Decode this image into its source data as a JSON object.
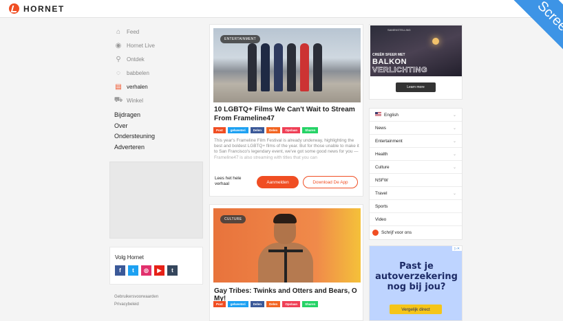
{
  "header": {
    "brand": "HORNET"
  },
  "nav": [
    {
      "label": "Feed",
      "icon": "home-icon",
      "active": false
    },
    {
      "label": "Hornet Live",
      "icon": "broadcast-icon",
      "active": false
    },
    {
      "label": "Ontdek",
      "icon": "search-icon",
      "active": false
    },
    {
      "label": "babbelen",
      "icon": "chat-icon",
      "active": false
    },
    {
      "label": "verhalen",
      "icon": "stories-icon",
      "active": true
    },
    {
      "label": "Winkel",
      "icon": "cart-icon",
      "active": false
    }
  ],
  "links": [
    "Bijdragen",
    "Over",
    "Ondersteuning",
    "Adverteren"
  ],
  "follow": {
    "title": "Volg Hornet",
    "networks": [
      "facebook-icon",
      "twitter-icon",
      "instagram-icon",
      "youtube-icon",
      "tumblr-icon"
    ]
  },
  "footer": [
    "Gebruikersvoorwaarden",
    "Privacybeleid"
  ],
  "posts": [
    {
      "tag": "ENTERTAINMENT",
      "title": "10 LGBTQ+ Films We Can't Wait to Stream From Frameline47",
      "shares": [
        "Post",
        "gelweeteri",
        "Delen",
        "Delen",
        "Opslaan",
        "Sharen"
      ],
      "excerpt": "This year's Frameline Film Festival is already underway, highlighting the best and boldest LGBTQ+ films of the year. But for those unable to make it to San Francisco's legendary event, we've got some good news for you — Frameline47 is also streaming with titles that you can",
      "read_more": "Lees het hele verhaal",
      "signup": "Aanmelden",
      "download": "Download De App"
    },
    {
      "tag": "CULTURE",
      "title": "Gay Tribes: Twinks and Otters and Bears, O My!",
      "shares": [
        "Post",
        "gelweeteri",
        "Delen",
        "Delen",
        "Opslaan",
        "Sharen"
      ]
    }
  ],
  "ad_top": {
    "brand": "SAMENSTELLING",
    "line1": "CREËR SFEER MET",
    "line2": "BALKON",
    "line3": "VERLICHTING",
    "button": "Learn more"
  },
  "categories": [
    {
      "label": "English",
      "flag": true,
      "chevron": true
    },
    {
      "label": "News",
      "chevron": true
    },
    {
      "label": "Entertainment",
      "chevron": true
    },
    {
      "label": "Health",
      "chevron": true
    },
    {
      "label": "Culture",
      "chevron": true
    },
    {
      "label": "NSFW",
      "chevron": false
    },
    {
      "label": "Travel",
      "chevron": true
    },
    {
      "label": "Sports",
      "chevron": false
    },
    {
      "label": "Video",
      "chevron": false
    }
  ],
  "write_for_us": "Schrijf voor ons",
  "ad_bottom": {
    "headline": "Past je autoverzekering nog bij jou?",
    "button": "Vergelijk direct"
  },
  "watermark": "Screenshot",
  "colors": {
    "accent": "#f04e23",
    "facebook": "#3b5998",
    "twitter": "#1da1f2",
    "instagram": "#e1306c",
    "youtube": "#e62117",
    "tumblr": "#35465c",
    "whatsapp": "#25d366",
    "pocket": "#ef4056",
    "ribbon": "#3d94e6"
  }
}
